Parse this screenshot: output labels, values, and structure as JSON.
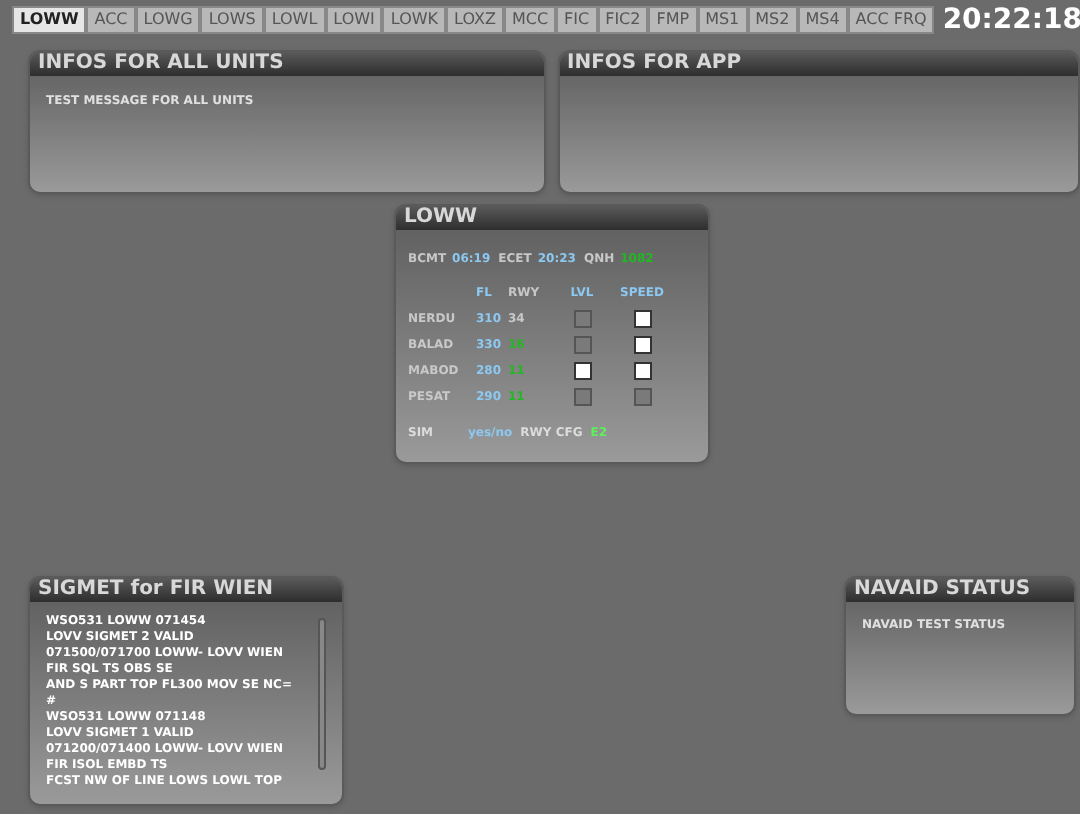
{
  "tabs": [
    {
      "label": "LOWW",
      "selected": true
    },
    {
      "label": "ACC",
      "selected": false
    },
    {
      "label": "LOWG",
      "selected": false
    },
    {
      "label": "LOWS",
      "selected": false
    },
    {
      "label": "LOWL",
      "selected": false
    },
    {
      "label": "LOWI",
      "selected": false
    },
    {
      "label": "LOWK",
      "selected": false
    },
    {
      "label": "LOXZ",
      "selected": false
    },
    {
      "label": "MCC",
      "selected": false
    },
    {
      "label": "FIC",
      "selected": false
    },
    {
      "label": "FIC2",
      "selected": false
    },
    {
      "label": "FMP",
      "selected": false
    },
    {
      "label": "MS1",
      "selected": false
    },
    {
      "label": "MS2",
      "selected": false
    },
    {
      "label": "MS4",
      "selected": false
    },
    {
      "label": "ACC FRQ",
      "selected": false
    }
  ],
  "clock": "20:22:18",
  "infos_all_units": {
    "title": "INFOS FOR ALL UNITS",
    "message": "TEST MESSAGE FOR ALL UNITS"
  },
  "infos_app": {
    "title": "INFOS FOR APP"
  },
  "airport": {
    "title": "LOWW",
    "times": [
      {
        "label": "BCMT",
        "value": "06:19",
        "kind": "time"
      },
      {
        "label": "ECET",
        "value": "20:23",
        "kind": "time"
      },
      {
        "label": "QNH",
        "value": "1082",
        "kind": "pressure"
      }
    ],
    "columns": [
      "FL",
      "RWY",
      "LVL",
      "SPEED"
    ],
    "rows": [
      {
        "name": "NERDU",
        "fl": "310",
        "rwy": "34",
        "rwy_active": false,
        "lvl_disabled": true,
        "speed_disabled": false
      },
      {
        "name": "BALAD",
        "fl": "330",
        "rwy": "16",
        "rwy_active": true,
        "lvl_disabled": true,
        "speed_disabled": false
      },
      {
        "name": "MABOD",
        "fl": "280",
        "rwy": "11",
        "rwy_active": true,
        "lvl_disabled": false,
        "speed_disabled": false
      },
      {
        "name": "PESAT",
        "fl": "290",
        "rwy": "11",
        "rwy_active": true,
        "lvl_disabled": true,
        "speed_disabled": true
      }
    ],
    "sim_label": "SIM",
    "sim_value": "yes/no",
    "rwy_cfg_label": "RWY CFG",
    "rwy_cfg_value": "E2"
  },
  "sigmet": {
    "title": "SIGMET for FIR WIEN",
    "lines": [
      "WSO531 LOWW 071454",
      "LOVV SIGMET 2 VALID",
      "071500/071700 LOWW- LOVV WIEN",
      "FIR SQL TS OBS SE",
      "AND S PART TOP FL300 MOV SE NC=",
      "#",
      "WSO531 LOWW 071148",
      "LOVV SIGMET 1 VALID",
      "071200/071400 LOWW- LOVV WIEN",
      "FIR ISOL EMBD TS",
      "FCST NW OF LINE LOWS LOWL TOP"
    ]
  },
  "navaid": {
    "title": "NAVAID STATUS",
    "message": "NAVAID TEST STATUS"
  }
}
